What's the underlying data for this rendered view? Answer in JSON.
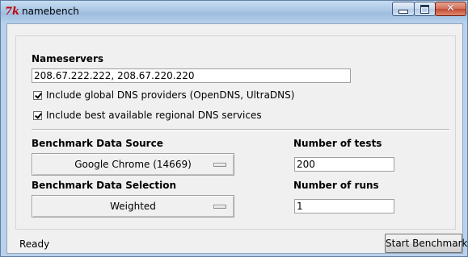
{
  "window": {
    "title": "namebench",
    "icon": "tk-feather-icon",
    "buttons": [
      "minimize",
      "maximize",
      "close"
    ]
  },
  "nameservers": {
    "label": "Nameservers",
    "value": "208.67.222.222, 208.67.220.220"
  },
  "options": [
    {
      "label": "Include global DNS providers (OpenDNS, UltraDNS)",
      "checked": true
    },
    {
      "label": "Include best available regional DNS services",
      "checked": true
    }
  ],
  "data_source": {
    "label": "Benchmark Data Source",
    "selected": "Google Chrome (14669)"
  },
  "data_selection": {
    "label": "Benchmark Data Selection",
    "selected": "Weighted"
  },
  "num_tests": {
    "label": "Number of tests",
    "value": "200"
  },
  "num_runs": {
    "label": "Number of runs",
    "value": "1"
  },
  "status": "Ready",
  "start_button": "Start Benchmark"
}
